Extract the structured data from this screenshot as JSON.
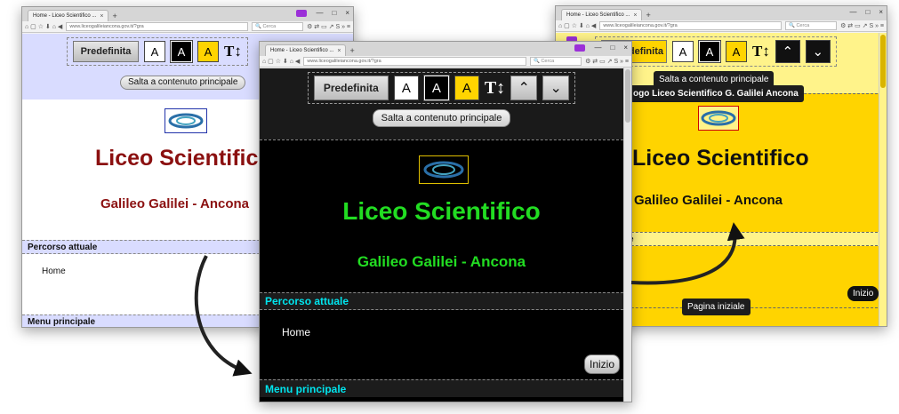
{
  "browser": {
    "tab_title": "Home - Liceo Scientifico ...",
    "tab_close": "×",
    "new_tab": "+",
    "url": "www.liceogalileiancona.gov.it/?gra",
    "search_placeholder": "Cerca",
    "window_controls": [
      "—",
      "□",
      "×"
    ]
  },
  "toolbar": {
    "default_label": "Predefinita",
    "contrast_white": "A",
    "contrast_black": "A",
    "contrast_yellow": "A",
    "text_size_icon": "T↕",
    "up_icon": "⌃",
    "down_icon": "⌄"
  },
  "skip_link": "Salta a contenuto principale",
  "site": {
    "title": "Liceo Scientifico",
    "subtitle": "Galileo Galilei - Ancona",
    "logo_tooltip": "Logo Liceo Scientifico G. Galilei Ancona",
    "logo_tooltip_visible": "ogo Liceo Scientifico G. Galilei Ancona"
  },
  "sections": {
    "breadcrumb_header": "Percorso attuale",
    "breadcrumb_home": "Home",
    "menu_header": "Menu principale",
    "top_button": "Inizio",
    "home_tooltip": "Pagina iniziale",
    "partial_e": "e"
  },
  "windows": {
    "left": {
      "theme": "default",
      "title_color": "#8b1010",
      "bar_color": "#d9dcff"
    },
    "center": {
      "theme": "black",
      "title_color": "#22dd22",
      "bar_color": "#00e5ee"
    },
    "right": {
      "theme": "yellow",
      "title_color": "#111111",
      "bar_color": "#ffd400"
    }
  }
}
